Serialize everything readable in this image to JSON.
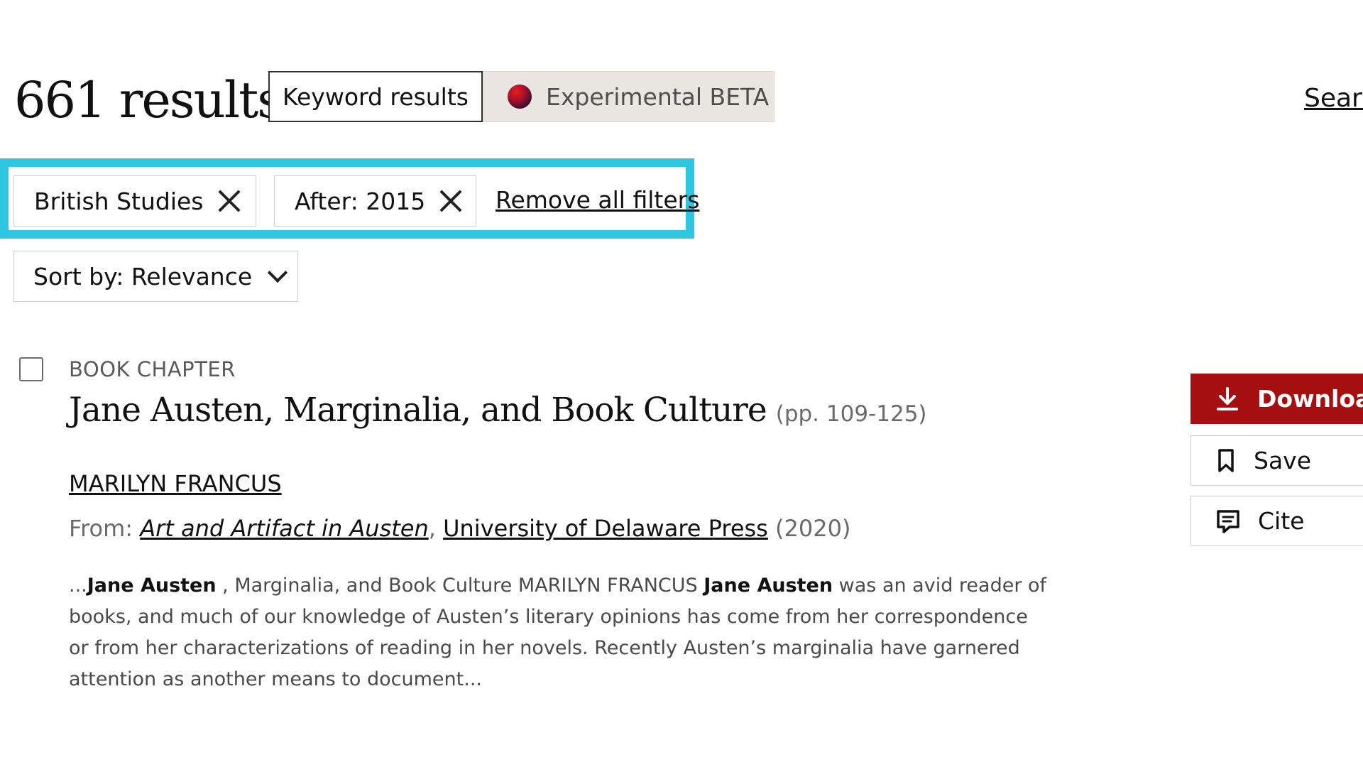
{
  "header": {
    "results_count": "661 results",
    "modes": {
      "keyword": "Keyword results",
      "experimental": "Experimental BETA"
    },
    "search_link": "Searc"
  },
  "filters": {
    "chips": [
      {
        "label": "British Studies"
      },
      {
        "label": "After: 2015"
      }
    ],
    "remove_all": "Remove all filters",
    "highlight_color": "#2ec6e0"
  },
  "sort": {
    "label": "Sort by: Relevance"
  },
  "results": [
    {
      "content_type": "BOOK CHAPTER",
      "title": "Jane Austen, Marginalia, and Book Culture",
      "pages": "(pp. 109-125)",
      "author": "MARILYN FRANCUS",
      "from_label": "From:",
      "book": "Art and Artifact in Austen",
      "separator": ",",
      "publisher": "University of Delaware Press",
      "year": "(2020)",
      "snippet": {
        "p1": "...",
        "b1": "Jane Austen",
        "p2": " , Marginalia, and Book Culture MARILYN FRANCUS ",
        "b2": "Jane Austen",
        "p3": " was an avid reader of books, and much of our knowledge of Austen’s literary opinions has come from her correspondence or from her characterizations of reading in her novels. Recently Austen’s marginalia have garnered attention as another means to document..."
      },
      "actions": {
        "download": "Download",
        "save": "Save",
        "cite": "Cite"
      }
    }
  ],
  "colors": {
    "download_bg": "#a50f0f",
    "experimental_bg": "#e9e6e1"
  },
  "icons": [
    "beta-dot-icon",
    "close-icon",
    "chevron-down-icon",
    "download-icon",
    "bookmark-icon",
    "cite-icon",
    "checkbox-icon"
  ]
}
